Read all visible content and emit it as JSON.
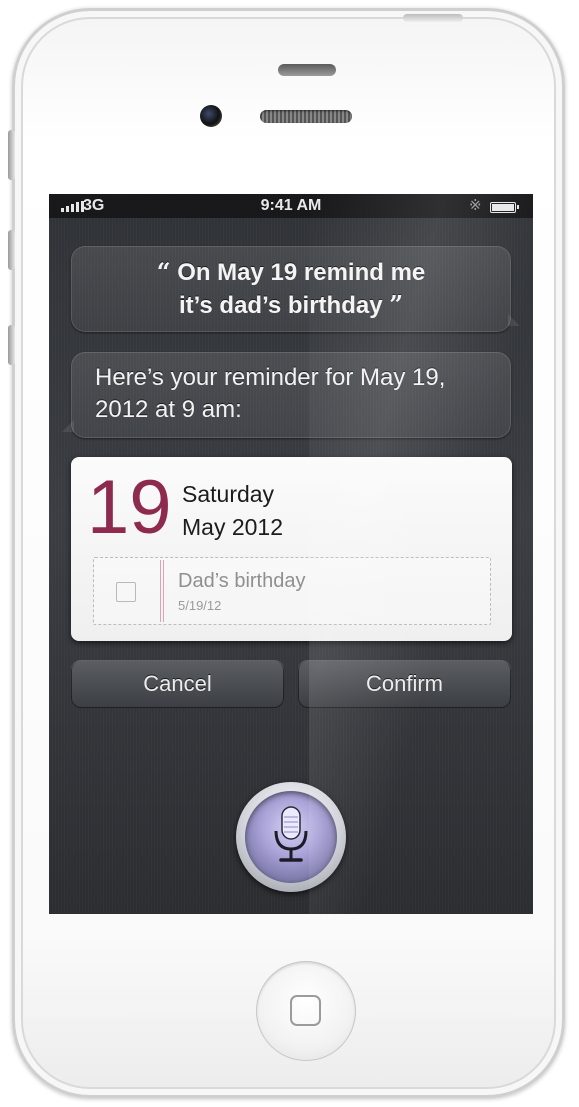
{
  "status_bar": {
    "network": "3G",
    "time": "9:41 AM",
    "bluetooth_icon": "bluetooth-icon",
    "battery_icon": "battery-icon"
  },
  "user_query": {
    "open_quote": "“",
    "line1": "On May 19 remind me",
    "line2": "it’s dad’s birthday",
    "close_quote": "”"
  },
  "siri_response": {
    "text": "Here’s your reminder for May 19, 2012 at 9 am:"
  },
  "reminder_card": {
    "day": "19",
    "weekday": "Saturday",
    "month_year": "May 2012",
    "title": "Dad’s birthday",
    "date": "5/19/12",
    "completed": false
  },
  "actions": {
    "cancel_label": "Cancel",
    "confirm_label": "Confirm"
  },
  "mic": {
    "icon": "microphone-icon"
  },
  "colors": {
    "day_accent": "#8d2a4e",
    "screen_background": "#33363a",
    "card_background": "#f5f5f5"
  }
}
